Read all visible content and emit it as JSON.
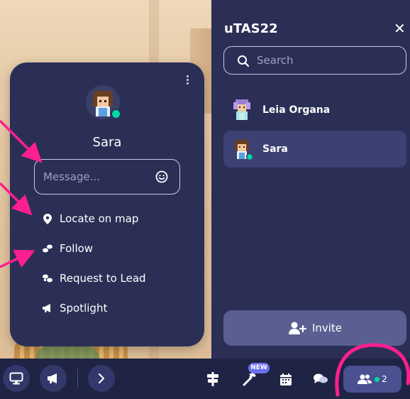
{
  "profile_card": {
    "name": "Sara",
    "message_placeholder": "Message...",
    "actions": [
      {
        "label": "Locate on map",
        "icon": "location-pin-icon"
      },
      {
        "label": "Follow",
        "icon": "follow-icon"
      },
      {
        "label": "Request to Lead",
        "icon": "request-lead-icon"
      },
      {
        "label": "Spotlight",
        "icon": "spotlight-icon"
      }
    ]
  },
  "sidebar": {
    "title": "uTAS22",
    "close_glyph": "✕",
    "search_placeholder": "Search",
    "people": [
      {
        "name": "Leia Organa",
        "selected": false
      },
      {
        "name": "Sara",
        "selected": true
      }
    ],
    "invite_label": "Invite"
  },
  "bottom_bar": {
    "new_badge": "NEW",
    "participant_count": "2",
    "tools": [
      "screen-share-icon",
      "megaphone-icon",
      "chevron-right-icon",
      "signpost-icon",
      "hammer-icon",
      "calendar-icon",
      "chat-icon",
      "people-icon"
    ]
  },
  "colors": {
    "panel": "#2b2f55",
    "bar": "#1f2344",
    "status_online": "#06d6a0",
    "annotation": "#ff1f8e",
    "new_badge": "#6b70f0"
  }
}
